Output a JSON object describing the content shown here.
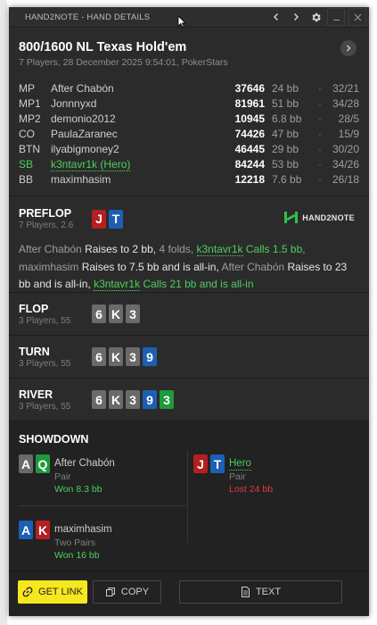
{
  "window": {
    "title": "HAND2NOTE - HAND DETAILS",
    "buttons": {
      "prev": "‹",
      "next": "›",
      "minimize": "—",
      "close": "✕"
    }
  },
  "hand": {
    "game": "800/1600 NL Texas Hold'em",
    "subtitle": "7 Players, 28 December 2025 9:54:01, PokerStars"
  },
  "players": [
    {
      "pos": "MP",
      "name": "After Chabón",
      "stack": "37646",
      "bb": "24 bb",
      "vpip": "32/21",
      "hero": false
    },
    {
      "pos": "MP1",
      "name": "Jonnnyxd",
      "stack": "81961",
      "bb": "51 bb",
      "vpip": "34/28",
      "hero": false
    },
    {
      "pos": "MP2",
      "name": "demonio2012",
      "stack": "10945",
      "bb": "6.8 bb",
      "vpip": "28/5",
      "hero": false
    },
    {
      "pos": "CO",
      "name": "PaulaZaranec",
      "stack": "74426",
      "bb": "47 bb",
      "vpip": "15/9",
      "hero": false
    },
    {
      "pos": "BTN",
      "name": "ilyabigmoney2",
      "stack": "46445",
      "bb": "29 bb",
      "vpip": "30/20",
      "hero": false
    },
    {
      "pos": "SB",
      "name": "k3ntavr1k (Hero)",
      "stack": "84244",
      "bb": "53 bb",
      "vpip": "34/26",
      "hero": true
    },
    {
      "pos": "BB",
      "name": "maximhasim",
      "stack": "12218",
      "bb": "7.6 bb",
      "vpip": "26/18",
      "hero": false
    }
  ],
  "preflop": {
    "title": "PREFLOP",
    "sub": "7 Players, 2.6",
    "hero_cards": [
      {
        "rank": "J",
        "suit": "h"
      },
      {
        "rank": "T",
        "suit": "d"
      }
    ],
    "brand": "HAND2NOTE",
    "actions": {
      "p1": "After Chabón",
      "a1": "Raises to 2 bb,",
      "folds": "4 folds,",
      "hero1": "k3ntavr1k",
      "ha1": "Calls 1.5 bb,",
      "p2": "maximhasim",
      "a2": "Raises to 7.5 bb and is all-in,",
      "p3": "After Chabón",
      "a3": "Raises to 23 bb and is all-in,",
      "hero2": "k3ntavr1k",
      "ha2": "Calls 21 bb and is all-in"
    }
  },
  "flop": {
    "title": "FLOP",
    "sub": "3 Players, 55",
    "cards": [
      {
        "rank": "6",
        "suit": "s"
      },
      {
        "rank": "K",
        "suit": "s"
      },
      {
        "rank": "3",
        "suit": "s"
      }
    ]
  },
  "turn": {
    "title": "TURN",
    "sub": "3 Players, 55",
    "cards": [
      {
        "rank": "6",
        "suit": "s"
      },
      {
        "rank": "K",
        "suit": "s"
      },
      {
        "rank": "3",
        "suit": "s"
      },
      {
        "rank": "9",
        "suit": "d"
      }
    ]
  },
  "river": {
    "title": "RIVER",
    "sub": "3 Players, 55",
    "cards": [
      {
        "rank": "6",
        "suit": "s"
      },
      {
        "rank": "K",
        "suit": "s"
      },
      {
        "rank": "3",
        "suit": "s"
      },
      {
        "rank": "9",
        "suit": "d"
      },
      {
        "rank": "3",
        "suit": "c"
      }
    ]
  },
  "showdown": {
    "title": "SHOWDOWN",
    "entries": [
      {
        "name": "After Chabón",
        "hand": "Pair",
        "result": "Won 8.3 bb",
        "won": true,
        "hero": false,
        "cards": [
          {
            "rank": "A",
            "suit": "s"
          },
          {
            "rank": "Q",
            "suit": "c"
          }
        ]
      },
      {
        "name": "Hero",
        "hand": "Pair",
        "result": "Lost 24 bb",
        "won": false,
        "hero": true,
        "cards": [
          {
            "rank": "J",
            "suit": "h"
          },
          {
            "rank": "T",
            "suit": "d"
          }
        ]
      },
      {
        "name": "maximhasim",
        "hand": "Two Pairs",
        "result": "Won 16 bb",
        "won": true,
        "hero": false,
        "cards": [
          {
            "rank": "A",
            "suit": "d"
          },
          {
            "rank": "K",
            "suit": "h"
          }
        ]
      }
    ]
  },
  "footer": {
    "get_link": "GET LINK",
    "copy": "COPY",
    "text": "TEXT"
  },
  "colors": {
    "accent": "#f5e81f",
    "hero": "#4ccf5a",
    "lost": "#e03a3a",
    "spade": "#6a6a6a",
    "heart": "#b51f1f",
    "diamond": "#1d5fb3",
    "club": "#1e9a3c"
  },
  "icons": {
    "next_hand": "chevron-right-icon",
    "settings": "gear-icon",
    "link": "link-icon",
    "copy": "copy-icon",
    "text": "document-icon"
  }
}
